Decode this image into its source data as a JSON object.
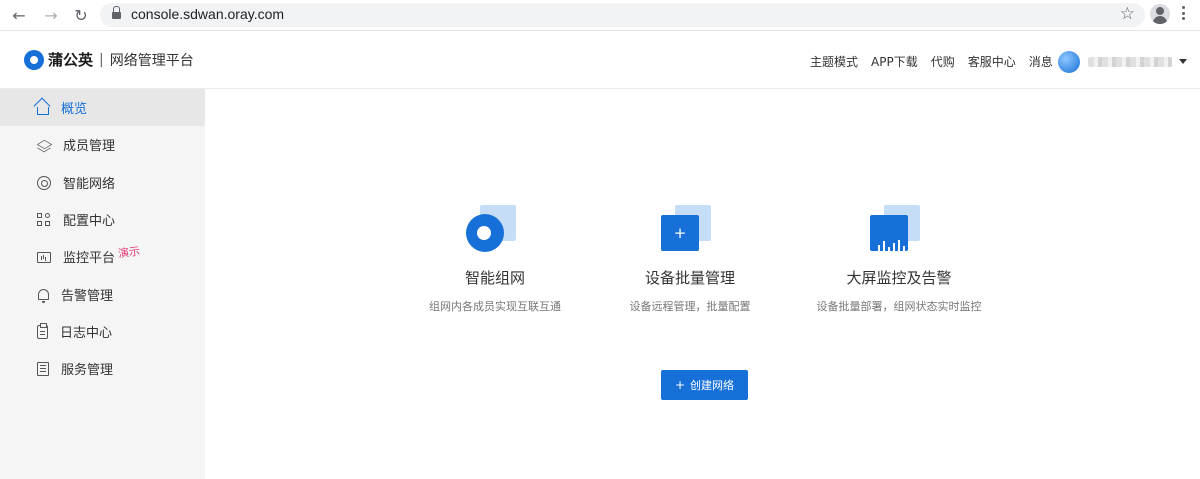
{
  "browser": {
    "url": "console.sdwan.oray.com"
  },
  "header": {
    "brand": "蒲公英",
    "separator": "|",
    "subtitle": "网络管理平台",
    "nav": [
      "主题模式",
      "APP下载",
      "代购",
      "客服中心",
      "消息"
    ]
  },
  "sidebar": {
    "items": [
      {
        "label": "概览",
        "icon": "home-icon",
        "active": true
      },
      {
        "label": "成员管理",
        "icon": "layers-icon"
      },
      {
        "label": "智能网络",
        "icon": "network-icon"
      },
      {
        "label": "配置中心",
        "icon": "grid-icon"
      },
      {
        "label": "监控平台",
        "icon": "monitor-icon",
        "badge": "演示"
      },
      {
        "label": "告警管理",
        "icon": "bell-icon"
      },
      {
        "label": "日志中心",
        "icon": "clipboard-icon"
      },
      {
        "label": "服务管理",
        "icon": "list-icon"
      }
    ]
  },
  "features": [
    {
      "title": "智能组网",
      "desc": "组网内各成员实现互联互通",
      "icon": "network-logo-icon"
    },
    {
      "title": "设备批量管理",
      "desc": "设备远程管理，批量配置",
      "icon": "plus-square-icon",
      "glyph": "+"
    },
    {
      "title": "大屏监控及告警",
      "desc": "设备批量部署，组网状态实时监控",
      "icon": "bar-chart-icon"
    }
  ],
  "create_button": {
    "plus": "+",
    "label": "创建网络"
  },
  "colors": {
    "accent": "#1670d8",
    "accent_light": "#c6ddf8",
    "badge": "#e63c74",
    "sidebar_bg": "#f5f5f5"
  }
}
